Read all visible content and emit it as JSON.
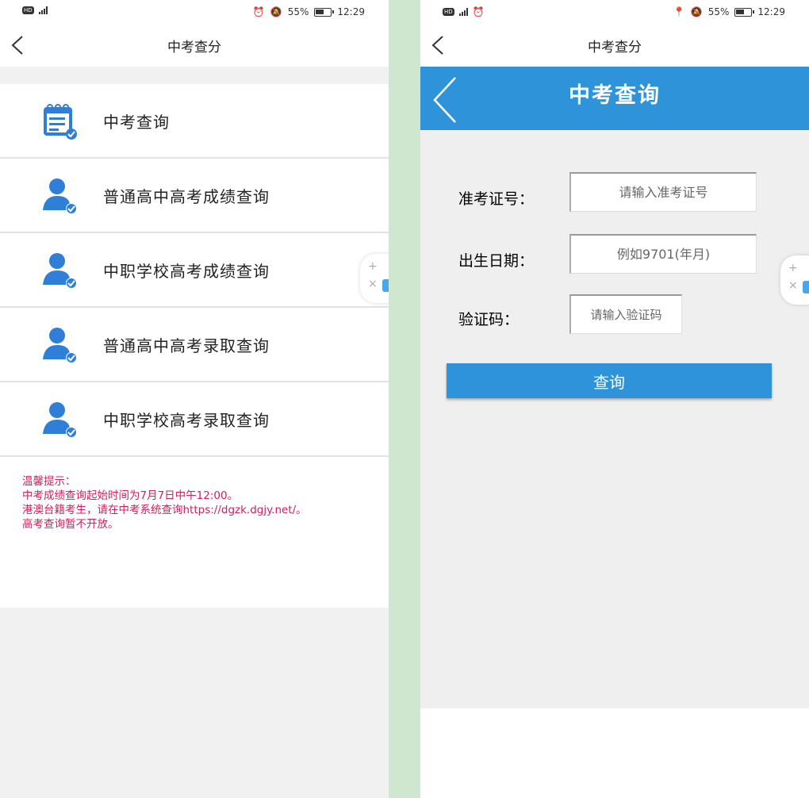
{
  "left": {
    "status": {
      "battery": "55%",
      "time": "12:29"
    },
    "nav": {
      "title": "中考查分"
    },
    "menu": [
      {
        "label": "中考查询",
        "icon": "calendar-list-icon"
      },
      {
        "label": "普通高中高考成绩查询",
        "icon": "user-check-icon"
      },
      {
        "label": "中职学校高考成绩查询",
        "icon": "user-check-icon"
      },
      {
        "label": "普通高中高考录取查询",
        "icon": "user-check-icon"
      },
      {
        "label": "中职学校高考录取查询",
        "icon": "user-check-icon"
      }
    ],
    "tips": [
      "温馨提示：",
      "中考成绩查询起始时间为7月7日中午12:00。",
      "港澳台籍考生，请在中考系统查询https://dgzk.dgjy.net/。",
      "高考查询暂不开放。"
    ],
    "floater": {
      "plus": "+",
      "close": "×"
    }
  },
  "right": {
    "status": {
      "battery": "55%",
      "time": "12:29"
    },
    "nav": {
      "title": "中考查分"
    },
    "banner": {
      "title": "中考查询"
    },
    "form": {
      "admission": {
        "label": "准考证号：",
        "placeholder": "请输入准考证号"
      },
      "birth": {
        "label": "出生日期：",
        "placeholder": "例如9701(年月)"
      },
      "captcha": {
        "label": "验证码：",
        "placeholder": "请输入验证码"
      },
      "submit": "查询"
    },
    "floater": {
      "plus": "+",
      "close": "×"
    }
  },
  "colors": {
    "accent": "#2f93d9",
    "tip": "#d0205a",
    "icon": "#2f7fd8"
  }
}
